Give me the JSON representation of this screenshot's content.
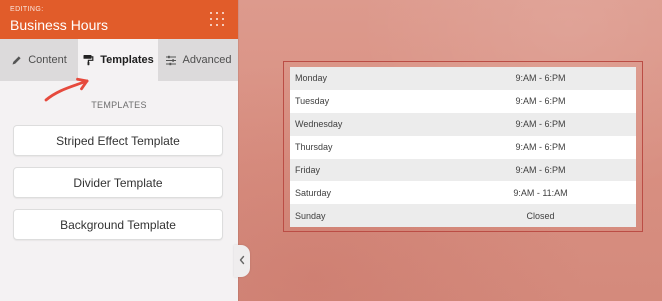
{
  "panel": {
    "header": {
      "kicker": "EDITING:",
      "title": "Business Hours"
    },
    "tabs": [
      {
        "label": "Content",
        "icon": "pencil-icon"
      },
      {
        "label": "Templates",
        "icon": "paint-roller-icon",
        "active": true
      },
      {
        "label": "Advanced",
        "icon": "sliders-icon"
      }
    ],
    "section_label": "TEMPLATES",
    "templates": [
      {
        "label": "Striped Effect Template"
      },
      {
        "label": "Divider Template"
      },
      {
        "label": "Background Template"
      }
    ]
  },
  "business_hours": {
    "rows": [
      {
        "day": "Monday",
        "hours": "9:AM - 6:PM"
      },
      {
        "day": "Tuesday",
        "hours": "9:AM - 6:PM"
      },
      {
        "day": "Wednesday",
        "hours": "9:AM - 6:PM"
      },
      {
        "day": "Thursday",
        "hours": "9:AM - 6:PM"
      },
      {
        "day": "Friday",
        "hours": "9:AM - 6:PM"
      },
      {
        "day": "Saturday",
        "hours": "9:AM - 11:AM"
      },
      {
        "day": "Sunday",
        "hours": "Closed"
      }
    ]
  },
  "colors": {
    "header_orange": "#e15c2a",
    "canvas_coral": "#d88f81",
    "annotation_arrow": "#e64a3d",
    "frame_border": "#bb4d45"
  }
}
